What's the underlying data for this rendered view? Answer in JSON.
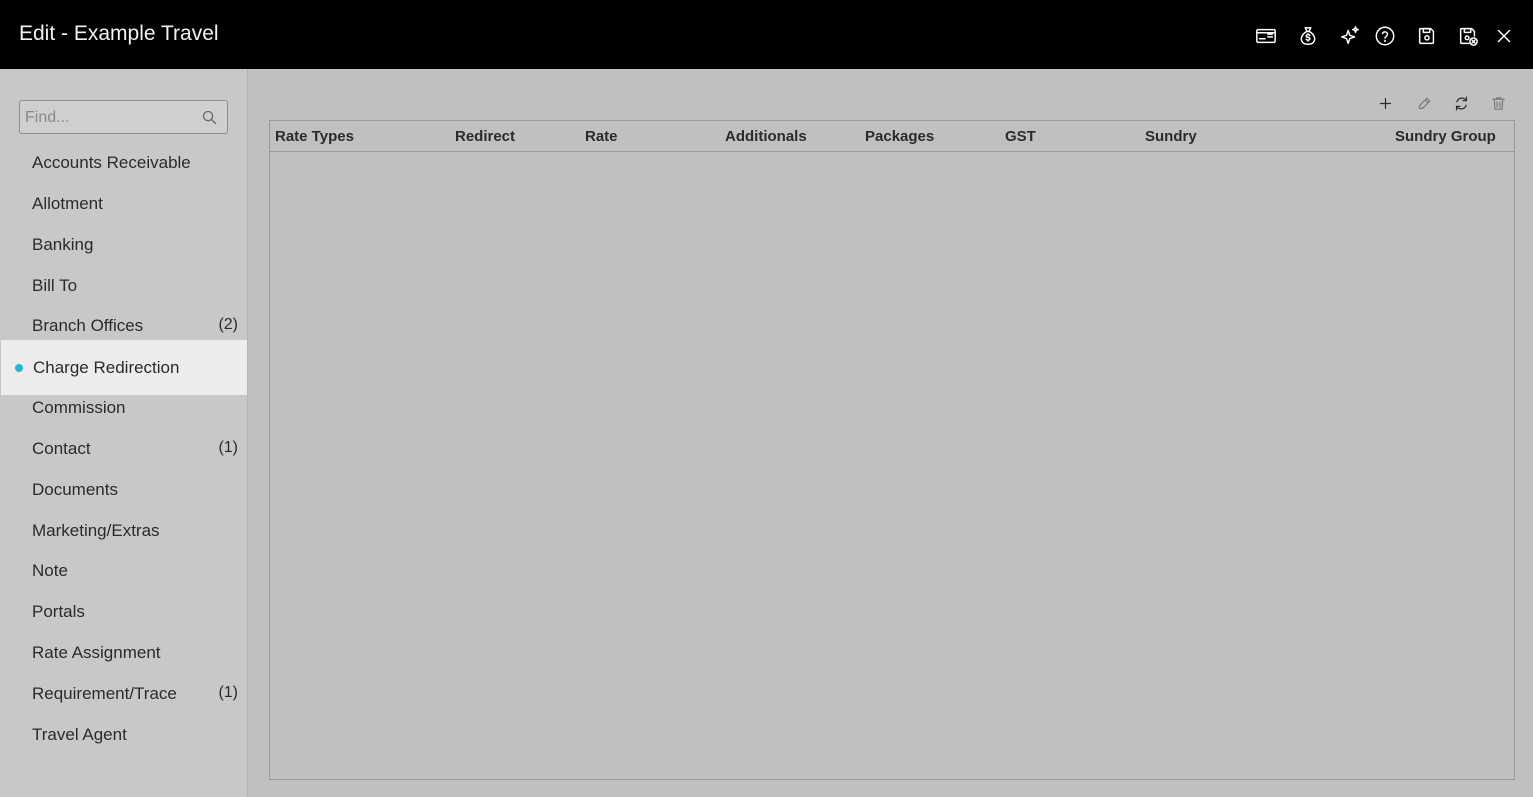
{
  "window": {
    "title": "Edit - Example Travel"
  },
  "header_icons": [
    {
      "name": "card-icon"
    },
    {
      "name": "money-bag-icon"
    },
    {
      "name": "sparkle-icon"
    },
    {
      "name": "help-icon"
    },
    {
      "name": "save-icon"
    },
    {
      "name": "save-close-icon"
    },
    {
      "name": "close-icon"
    }
  ],
  "sidebar": {
    "search": {
      "placeholder": "Find...",
      "value": ""
    },
    "items": [
      {
        "label": "Accounts Receivable",
        "count": ""
      },
      {
        "label": "Allotment",
        "count": ""
      },
      {
        "label": "Banking",
        "count": ""
      },
      {
        "label": "Bill To",
        "count": ""
      },
      {
        "label": "Branch Offices",
        "count": "(2)"
      },
      {
        "label": "Charge Redirection",
        "count": "",
        "active": true
      },
      {
        "label": "Commission",
        "count": ""
      },
      {
        "label": "Contact",
        "count": "(1)"
      },
      {
        "label": "Documents",
        "count": ""
      },
      {
        "label": "Marketing/Extras",
        "count": ""
      },
      {
        "label": "Note",
        "count": ""
      },
      {
        "label": "Portals",
        "count": ""
      },
      {
        "label": "Rate Assignment",
        "count": ""
      },
      {
        "label": "Requirement/Trace",
        "count": "(1)"
      },
      {
        "label": "Travel Agent",
        "count": ""
      }
    ],
    "active_indicator_color": "#1fb6d4"
  },
  "grid": {
    "toolbar": [
      {
        "name": "add-icon"
      },
      {
        "name": "edit-icon"
      },
      {
        "name": "refresh-icon"
      },
      {
        "name": "delete-icon"
      }
    ],
    "columns": [
      "Rate Types",
      "Redirect",
      "Rate",
      "Additionals",
      "Packages",
      "GST",
      "Sundry",
      "Sundry Group"
    ],
    "rows": []
  }
}
